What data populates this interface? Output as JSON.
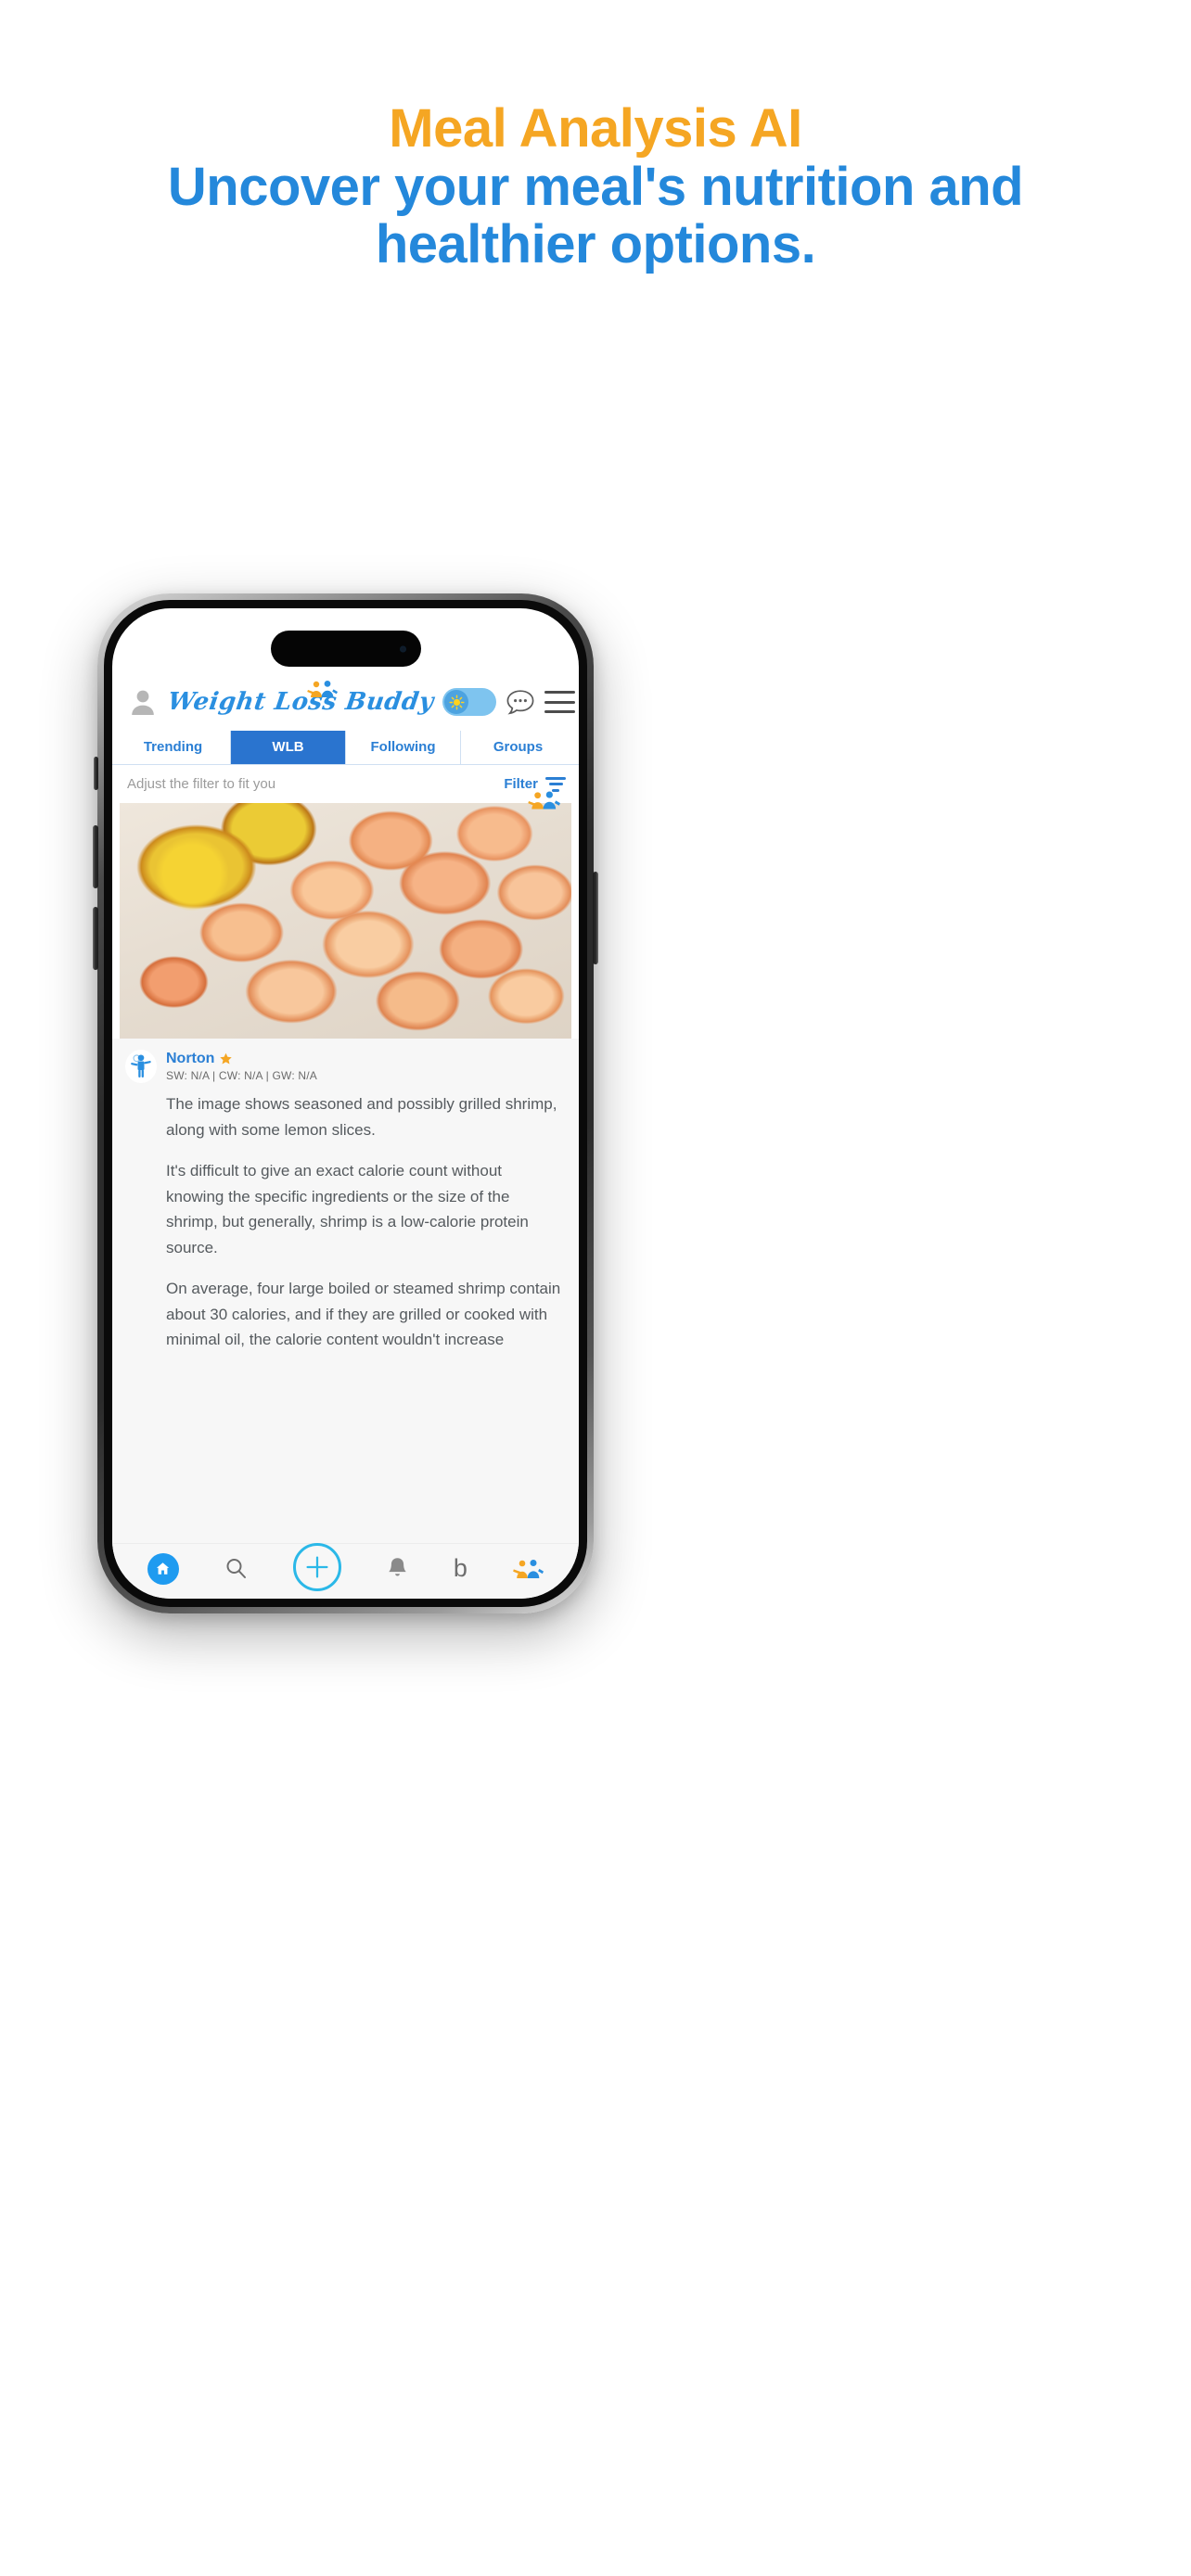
{
  "promo": {
    "line1": "Meal Analysis AI",
    "line2": "Uncover your meal's nutrition and healthier options.",
    "accent_orange": "#F5A623",
    "accent_blue": "#2488DB"
  },
  "app": {
    "logo_text": "Weight Loss Buddy",
    "icons": {
      "avatar": "user-avatar-icon",
      "logo_mark": "buddies-logo-icon",
      "theme_toggle": "sun-toggle-icon",
      "chat": "chat-bubble-icon",
      "menu": "hamburger-menu-icon"
    }
  },
  "tabs": [
    {
      "label": "Trending",
      "active": false
    },
    {
      "label": "WLB",
      "active": true
    },
    {
      "label": "Following",
      "active": false
    },
    {
      "label": "Groups",
      "active": false
    }
  ],
  "filter": {
    "hint": "Adjust the filter to fit you",
    "label": "Filter",
    "icon": "filter-funnel-icon"
  },
  "post": {
    "author": "Norton",
    "badge": "orange-star-badge",
    "stats": "SW: N/A | CW: N/A | GW: N/A",
    "media_alt": "grilled-shrimp-with-lemon-photo",
    "paragraphs": [
      "The image shows seasoned and possibly grilled shrimp, along with some lemon slices.",
      "It's difficult to give an exact calorie count without knowing the specific ingredients or the size of the shrimp, but generally, shrimp is a low-calorie protein source.",
      "On average, four large boiled or steamed shrimp contain about 30 calories, and if they are grilled or cooked with minimal oil, the calorie content wouldn't increase"
    ]
  },
  "bottom_nav": [
    {
      "name": "home",
      "icon": "home-icon",
      "active": true
    },
    {
      "name": "search",
      "icon": "search-icon",
      "active": false
    },
    {
      "name": "create",
      "icon": "plus-circle-icon",
      "active": false
    },
    {
      "name": "notifications",
      "icon": "bell-icon",
      "active": false
    },
    {
      "name": "buddy-b",
      "icon": "letter-b-icon",
      "label": "b",
      "active": false
    },
    {
      "name": "buddies",
      "icon": "buddies-icon",
      "active": false
    }
  ]
}
